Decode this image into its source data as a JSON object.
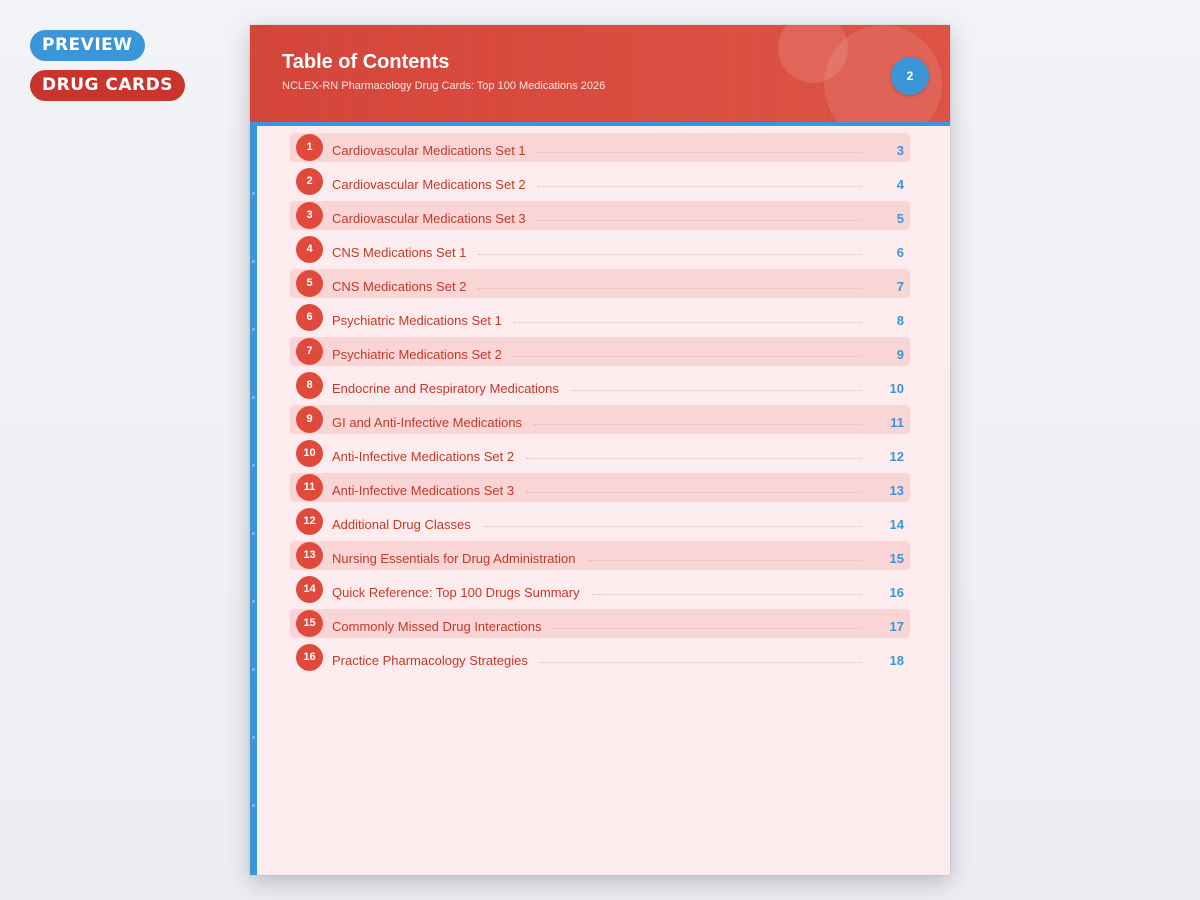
{
  "badges": {
    "preview": "PREVIEW",
    "drug_cards": "DRUG CARDS"
  },
  "header": {
    "title": "Table of Contents",
    "subtitle": "NCLEX-RN Pharmacology Drug Cards: Top 100 Medications 2026",
    "page_number": "2"
  },
  "colors": {
    "accent_red": "#db4a3c",
    "accent_blue": "#3a96d8",
    "page_bg": "#fdeced"
  },
  "toc": [
    {
      "num": "1",
      "label": "Cardiovascular Medications Set 1",
      "page": "3"
    },
    {
      "num": "2",
      "label": "Cardiovascular Medications Set 2",
      "page": "4"
    },
    {
      "num": "3",
      "label": "Cardiovascular Medications Set 3",
      "page": "5"
    },
    {
      "num": "4",
      "label": "CNS Medications Set 1",
      "page": "6"
    },
    {
      "num": "5",
      "label": "CNS Medications Set 2",
      "page": "7"
    },
    {
      "num": "6",
      "label": "Psychiatric Medications Set 1",
      "page": "8"
    },
    {
      "num": "7",
      "label": "Psychiatric Medications Set 2",
      "page": "9"
    },
    {
      "num": "8",
      "label": "Endocrine and Respiratory Medications",
      "page": "10"
    },
    {
      "num": "9",
      "label": "GI and Anti-Infective Medications",
      "page": "11"
    },
    {
      "num": "10",
      "label": "Anti-Infective Medications Set 2",
      "page": "12"
    },
    {
      "num": "11",
      "label": "Anti-Infective Medications Set 3",
      "page": "13"
    },
    {
      "num": "12",
      "label": "Additional Drug Classes",
      "page": "14"
    },
    {
      "num": "13",
      "label": "Nursing Essentials for Drug Administration",
      "page": "15"
    },
    {
      "num": "14",
      "label": "Quick Reference: Top 100 Drugs Summary",
      "page": "16"
    },
    {
      "num": "15",
      "label": "Commonly Missed Drug Interactions",
      "page": "17"
    },
    {
      "num": "16",
      "label": "Practice Pharmacology Strategies",
      "page": "18"
    }
  ]
}
